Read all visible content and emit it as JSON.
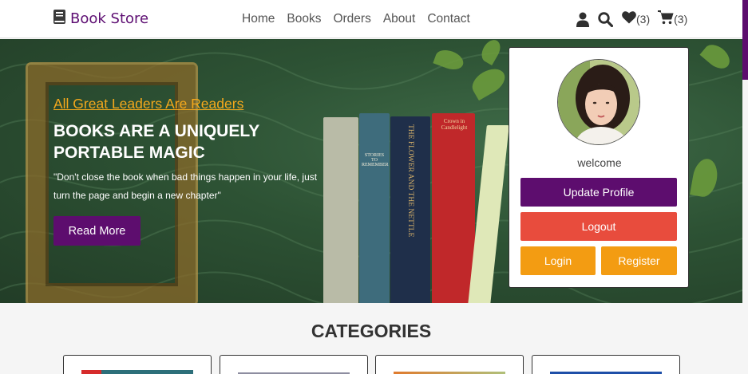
{
  "brand": {
    "name": "Book Store",
    "icon": "book-icon",
    "accent": "#5d0d6e"
  },
  "nav": [
    {
      "label": "Home"
    },
    {
      "label": "Books"
    },
    {
      "label": "Orders"
    },
    {
      "label": "About"
    },
    {
      "label": "Contact"
    }
  ],
  "header_icons": {
    "user": "user-icon",
    "search": "search-icon",
    "wishlist": {
      "icon": "heart-icon",
      "count": "(3)"
    },
    "cart": {
      "icon": "cart-icon",
      "count": "(3)"
    }
  },
  "hero": {
    "tagline": "All Great Leaders Are Readers",
    "title": "BOOKS ARE A UNIQUELY PORTABLE MAGIC",
    "quote": "\"Don't close the book when bad things happen in your life, just turn the page and begin a new chapter\"",
    "button": "Read More",
    "book_spines": [
      "THE FLOWER AND THE NETTLE",
      "Crown in Candlelight",
      "STORIES TO REMEMBER"
    ]
  },
  "profile": {
    "greeting": "welcome",
    "update_label": "Update Profile",
    "logout_label": "Logout",
    "login_label": "Login",
    "register_label": "Register",
    "colors": {
      "update": "#5d0d6e",
      "logout": "#e84c3d",
      "login": "#f39c12",
      "register": "#f39c12"
    }
  },
  "categories": {
    "heading": "CATEGORIES"
  }
}
